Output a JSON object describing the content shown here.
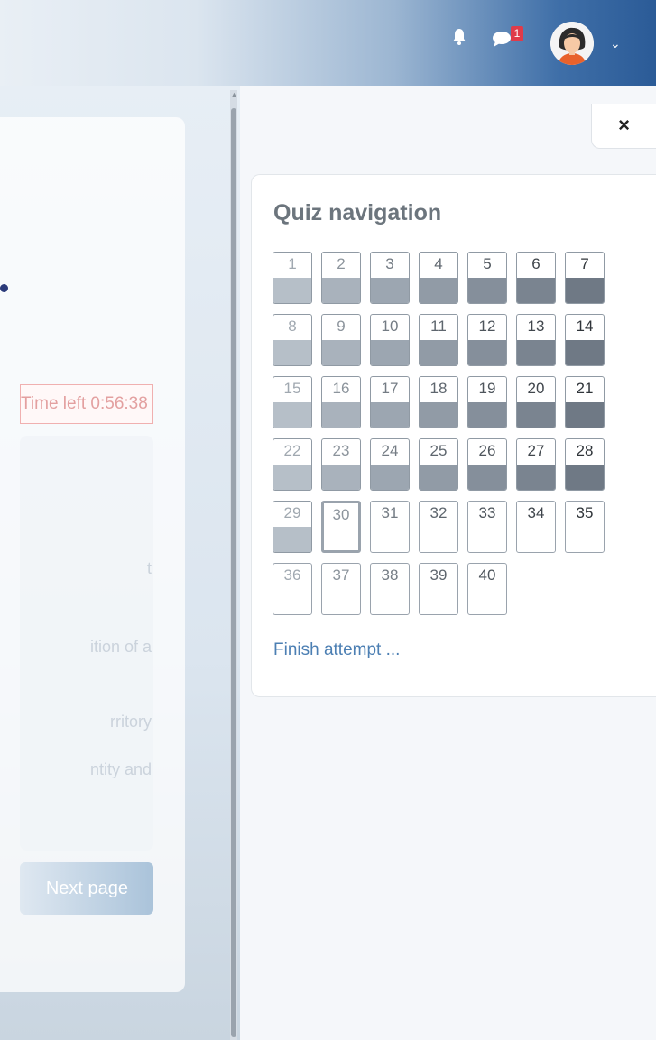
{
  "header": {
    "notification_icon": "bell-icon",
    "messages_icon": "chat-icon",
    "messages_badge": "1",
    "user_avatar": "avatar",
    "user_menu_icon": "chevron-down-icon"
  },
  "background_page": {
    "timer_text": "Time left 0:56:38",
    "question_fragments": [
      "t",
      "ition of a",
      "rritory",
      "ntity and"
    ],
    "next_button": "Next page"
  },
  "drawer": {
    "close_label": "×",
    "title": "Quiz navigation",
    "current_question": 30,
    "questions": [
      {
        "n": "1",
        "state": "answered"
      },
      {
        "n": "2",
        "state": "answered"
      },
      {
        "n": "3",
        "state": "answered"
      },
      {
        "n": "4",
        "state": "answered"
      },
      {
        "n": "5",
        "state": "answered"
      },
      {
        "n": "6",
        "state": "answered"
      },
      {
        "n": "7",
        "state": "answered"
      },
      {
        "n": "8",
        "state": "answered"
      },
      {
        "n": "9",
        "state": "answered"
      },
      {
        "n": "10",
        "state": "answered"
      },
      {
        "n": "11",
        "state": "answered"
      },
      {
        "n": "12",
        "state": "answered"
      },
      {
        "n": "13",
        "state": "answered"
      },
      {
        "n": "14",
        "state": "answered"
      },
      {
        "n": "15",
        "state": "answered"
      },
      {
        "n": "16",
        "state": "answered"
      },
      {
        "n": "17",
        "state": "answered"
      },
      {
        "n": "18",
        "state": "answered"
      },
      {
        "n": "19",
        "state": "answered"
      },
      {
        "n": "20",
        "state": "answered"
      },
      {
        "n": "21",
        "state": "answered"
      },
      {
        "n": "22",
        "state": "answered"
      },
      {
        "n": "23",
        "state": "answered"
      },
      {
        "n": "24",
        "state": "answered"
      },
      {
        "n": "25",
        "state": "answered"
      },
      {
        "n": "26",
        "state": "answered"
      },
      {
        "n": "27",
        "state": "answered"
      },
      {
        "n": "28",
        "state": "answered"
      },
      {
        "n": "29",
        "state": "answered"
      },
      {
        "n": "30",
        "state": "current"
      },
      {
        "n": "31",
        "state": "unanswered"
      },
      {
        "n": "32",
        "state": "unanswered"
      },
      {
        "n": "33",
        "state": "unanswered"
      },
      {
        "n": "34",
        "state": "unanswered"
      },
      {
        "n": "35",
        "state": "unanswered"
      },
      {
        "n": "36",
        "state": "unanswered"
      },
      {
        "n": "37",
        "state": "unanswered"
      },
      {
        "n": "38",
        "state": "unanswered"
      },
      {
        "n": "39",
        "state": "unanswered"
      },
      {
        "n": "40",
        "state": "unanswered"
      }
    ],
    "finish_link": "Finish attempt ..."
  }
}
